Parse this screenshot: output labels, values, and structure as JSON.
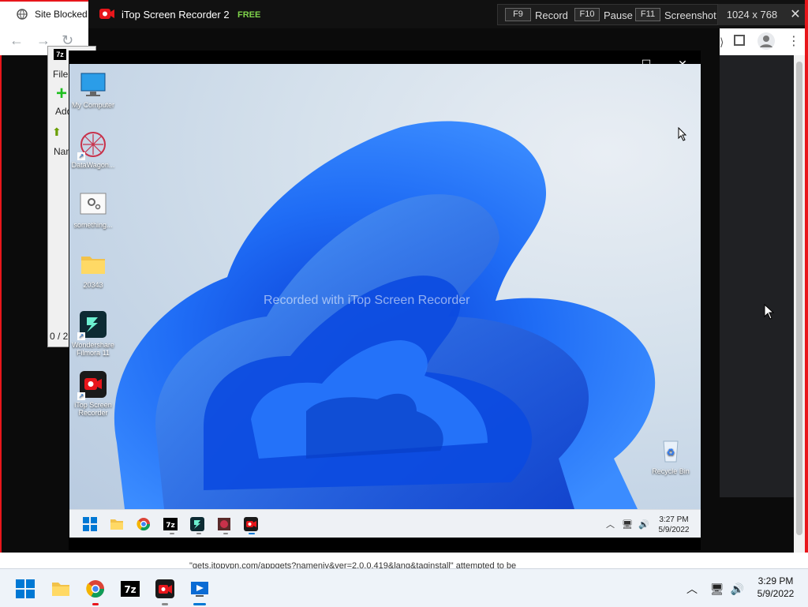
{
  "browser": {
    "tab_title": "Site Blocked",
    "blocked_message": "\"gets.itopvpn.com/appgets?nameniv&ver=2.0.0.419&lang&taginstall\" attempted to be"
  },
  "sevenzip": {
    "icon_text": "7z",
    "menu_file": "File",
    "add_label": "Add",
    "column_name": "Nam",
    "status": "0 / 2"
  },
  "recorder": {
    "app_title": "iTop Screen Recorder 2",
    "edition": "FREE",
    "hotkeys": [
      {
        "key": "F9",
        "label": "Record"
      },
      {
        "key": "F10",
        "label": "Pause"
      },
      {
        "key": "F11",
        "label": "Screenshot"
      }
    ],
    "resolution": "1024 x 768",
    "close": "✕"
  },
  "vm": {
    "watermark": "Recorded with iTop Screen Recorder",
    "window_controls": {
      "minimize": "—",
      "maximize": "☐",
      "close": "✕"
    },
    "desktop_icons": [
      {
        "label": "My Computer",
        "icon": "monitor-icon"
      },
      {
        "label": "DataWagon...",
        "icon": "datawagon-icon"
      },
      {
        "label": "something...",
        "icon": "settings-file-icon"
      },
      {
        "label": "20343",
        "icon": "folder-icon"
      },
      {
        "label": "Wondershare Filmora 11",
        "icon": "filmora-icon"
      },
      {
        "label": "iTop Screen Recorder",
        "icon": "itop-recorder-icon"
      }
    ],
    "recycle_bin_label": "Recycle Bin",
    "time": "3:27 PM",
    "date": "5/9/2022"
  },
  "host": {
    "time": "3:29 PM",
    "date": "5/9/2022"
  },
  "colors": {
    "recorder_accent": "#e8161b",
    "free_badge": "#7fd44b",
    "win_blue": "#1a6fd1"
  }
}
